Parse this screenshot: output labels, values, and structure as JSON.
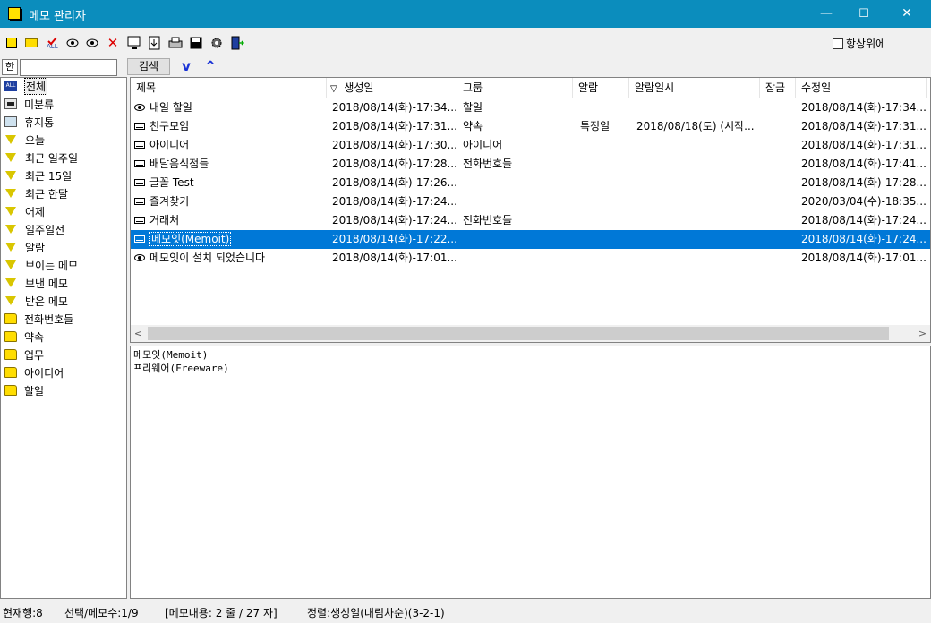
{
  "window": {
    "title": "메모 관리자",
    "minimize": "—",
    "maximize": "☐",
    "close": "✕"
  },
  "toolbar": {
    "always_on_top_label": "항상위에"
  },
  "search": {
    "ime_label": "한",
    "value": "",
    "button_label": "검색",
    "down_arrow": "v",
    "up_arrow": "^"
  },
  "sidebar": {
    "items": [
      {
        "label": "전체",
        "icon": "all-icon"
      },
      {
        "label": "미분류",
        "icon": "inbox-icon"
      },
      {
        "label": "휴지통",
        "icon": "trash-icon"
      },
      {
        "label": "오늘",
        "icon": "filter-icon"
      },
      {
        "label": "최근 일주일",
        "icon": "filter-icon"
      },
      {
        "label": "최근 15일",
        "icon": "filter-icon"
      },
      {
        "label": "최근 한달",
        "icon": "filter-icon"
      },
      {
        "label": "어제",
        "icon": "filter-icon"
      },
      {
        "label": "일주일전",
        "icon": "filter-icon"
      },
      {
        "label": "알람",
        "icon": "filter-icon"
      },
      {
        "label": "보이는 메모",
        "icon": "filter-icon"
      },
      {
        "label": "보낸 메모",
        "icon": "filter-icon"
      },
      {
        "label": "받은 메모",
        "icon": "filter-icon"
      },
      {
        "label": "전화번호들",
        "icon": "folder-icon"
      },
      {
        "label": "약속",
        "icon": "folder-icon"
      },
      {
        "label": "업무",
        "icon": "folder-icon"
      },
      {
        "label": "아이디어",
        "icon": "folder-icon"
      },
      {
        "label": "할일",
        "icon": "folder-icon"
      }
    ]
  },
  "list": {
    "columns": [
      "제목",
      "생성일",
      "그룹",
      "알람",
      "알람일시",
      "잠금",
      "수정일"
    ],
    "sort_indicator": "▽",
    "rows": [
      {
        "icon": "eye-icon",
        "title": "내일 할일",
        "created": "2018/08/14(화)-17:34...",
        "group": "할일",
        "alarm": "",
        "alarm_time": "",
        "lock": "",
        "modified": "2018/08/14(화)-17:34..."
      },
      {
        "icon": "memo-icon",
        "title": "친구모임",
        "created": "2018/08/14(화)-17:31...",
        "group": "약속",
        "alarm": "특정일",
        "alarm_time": "2018/08/18(토) (시작...",
        "lock": "",
        "modified": "2018/08/14(화)-17:31..."
      },
      {
        "icon": "memo-icon",
        "title": "아이디어",
        "created": "2018/08/14(화)-17:30...",
        "group": "아이디어",
        "alarm": "",
        "alarm_time": "",
        "lock": "",
        "modified": "2018/08/14(화)-17:31..."
      },
      {
        "icon": "memo-icon",
        "title": "배달음식점들",
        "created": "2018/08/14(화)-17:28...",
        "group": "전화번호들",
        "alarm": "",
        "alarm_time": "",
        "lock": "",
        "modified": "2018/08/14(화)-17:41..."
      },
      {
        "icon": "memo-icon",
        "title": "글꼴 Test",
        "created": "2018/08/14(화)-17:26...",
        "group": "",
        "alarm": "",
        "alarm_time": "",
        "lock": "",
        "modified": "2018/08/14(화)-17:28..."
      },
      {
        "icon": "memo-icon",
        "title": "즐겨찾기",
        "created": "2018/08/14(화)-17:24...",
        "group": "",
        "alarm": "",
        "alarm_time": "",
        "lock": "",
        "modified": "2020/03/04(수)-18:35..."
      },
      {
        "icon": "memo-icon",
        "title": "거래처",
        "created": "2018/08/14(화)-17:24...",
        "group": "전화번호들",
        "alarm": "",
        "alarm_time": "",
        "lock": "",
        "modified": "2018/08/14(화)-17:24..."
      },
      {
        "icon": "memo-icon",
        "title": "메모잇(Memoit)",
        "created": "2018/08/14(화)-17:22...",
        "group": "",
        "alarm": "",
        "alarm_time": "",
        "lock": "",
        "modified": "2018/08/14(화)-17:24...",
        "selected": true
      },
      {
        "icon": "eye-icon",
        "title": "메모잇이 설치 되었습니다",
        "created": "2018/08/14(화)-17:01...",
        "group": "",
        "alarm": "",
        "alarm_time": "",
        "lock": "",
        "modified": "2018/08/14(화)-17:01..."
      }
    ]
  },
  "content": {
    "lines": [
      "메모잇(Memoit)",
      "프리웨어(Freeware)"
    ]
  },
  "status": {
    "current_row": "현재행:8",
    "selection": "선택/메모수:1/9",
    "content_info": "[메모내용: 2 줄 / 27 자]",
    "sort": "정렬:생성일(내림차순)(3-2-1)"
  },
  "colors": {
    "titlebar": "#0b8dbd",
    "selection": "#0078d7",
    "arrow": "#1a33d6"
  }
}
